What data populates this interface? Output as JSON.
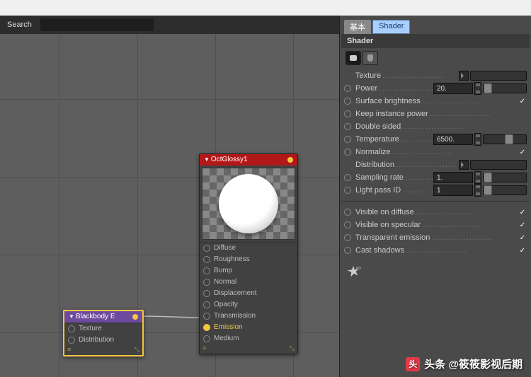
{
  "search_label": "Search",
  "node_glossy": {
    "title": "OctGlossy1",
    "inputs": [
      "Diffuse",
      "Roughness",
      "Bump",
      "Normal",
      "Displacement",
      "Opacity",
      "Transmission",
      "Emission",
      "Medium"
    ],
    "active_input": 7
  },
  "node_blackbody": {
    "title": "Blackbody E",
    "inputs": [
      "Texture",
      "Distribution"
    ]
  },
  "panel": {
    "tabs": {
      "basic": "基本",
      "shader": "Shader"
    },
    "header": "Shader",
    "params": [
      {
        "k": "texture",
        "label": "Texture",
        "type": "tex",
        "radio": false
      },
      {
        "k": "power",
        "label": "Power",
        "type": "num",
        "value": "20.",
        "radio": true,
        "slider": 0
      },
      {
        "k": "surfbright",
        "label": "Surface brightness",
        "type": "chk",
        "value": true,
        "radio": true
      },
      {
        "k": "keepinst",
        "label": "Keep instance power",
        "type": "chk",
        "value": false,
        "radio": true
      },
      {
        "k": "dblsided",
        "label": "Double sided",
        "type": "chk",
        "value": false,
        "radio": true
      },
      {
        "k": "temp",
        "label": "Temperature",
        "type": "num",
        "value": "6500.",
        "radio": true,
        "slider": 50
      },
      {
        "k": "normalize",
        "label": "Normalize",
        "type": "chk",
        "value": true,
        "radio": true
      },
      {
        "k": "distribution",
        "label": "Distribution",
        "type": "tex",
        "radio": false
      },
      {
        "k": "sampling",
        "label": "Sampling rate",
        "type": "num",
        "value": "1.",
        "radio": true,
        "slider": 0
      },
      {
        "k": "lightpass",
        "label": "Light pass ID",
        "type": "num",
        "value": "1",
        "radio": true,
        "slider": 0
      }
    ],
    "params2": [
      {
        "k": "vdiffuse",
        "label": "Visible on diffuse",
        "type": "chk",
        "value": true,
        "radio": true
      },
      {
        "k": "vspecular",
        "label": "Visible on specular",
        "type": "chk",
        "value": true,
        "radio": true
      },
      {
        "k": "temiss",
        "label": "Transparent emission",
        "type": "chk",
        "value": true,
        "radio": true
      },
      {
        "k": "castshad",
        "label": "Cast shadows",
        "type": "chk",
        "value": true,
        "radio": true
      }
    ]
  },
  "watermark": "头条 @筱筱影视后期"
}
